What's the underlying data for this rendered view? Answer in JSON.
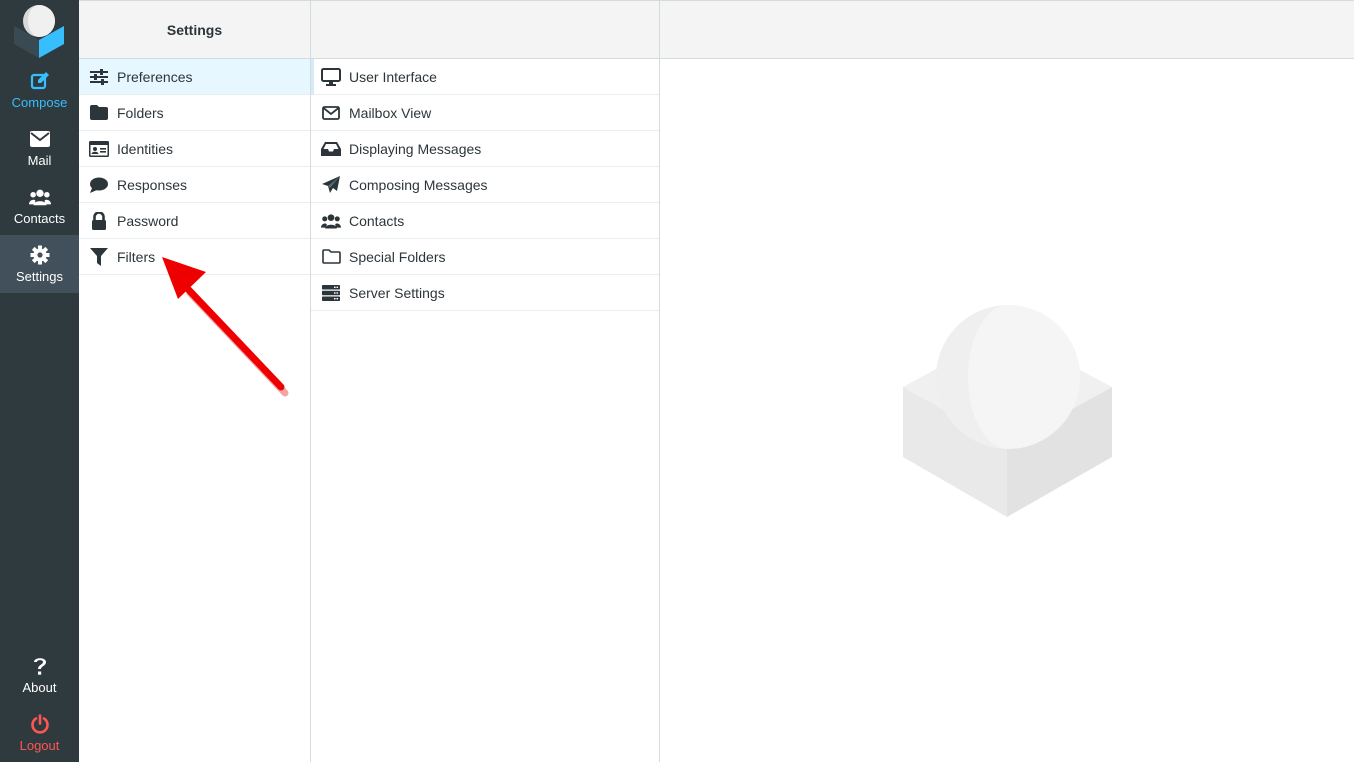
{
  "nav": {
    "items": [
      {
        "label": "Compose",
        "icon": "compose-icon"
      },
      {
        "label": "Mail",
        "icon": "envelope-icon"
      },
      {
        "label": "Contacts",
        "icon": "users-icon"
      },
      {
        "label": "Settings",
        "icon": "gear-icon"
      }
    ],
    "bottom": [
      {
        "label": "About",
        "icon": "question-icon"
      },
      {
        "label": "Logout",
        "icon": "power-icon"
      }
    ]
  },
  "settings": {
    "title": "Settings",
    "items": [
      {
        "label": "Preferences",
        "icon": "sliders-icon"
      },
      {
        "label": "Folders",
        "icon": "folder-icon"
      },
      {
        "label": "Identities",
        "icon": "id-card-icon"
      },
      {
        "label": "Responses",
        "icon": "comment-icon"
      },
      {
        "label": "Password",
        "icon": "lock-icon"
      },
      {
        "label": "Filters",
        "icon": "filter-icon"
      }
    ]
  },
  "preferences": {
    "items": [
      {
        "label": "User Interface",
        "icon": "monitor-icon"
      },
      {
        "label": "Mailbox View",
        "icon": "envelope-outline-icon"
      },
      {
        "label": "Displaying Messages",
        "icon": "inbox-icon"
      },
      {
        "label": "Composing Messages",
        "icon": "paper-plane-icon"
      },
      {
        "label": "Contacts",
        "icon": "users-icon"
      },
      {
        "label": "Special Folders",
        "icon": "folder-outline-icon"
      },
      {
        "label": "Server Settings",
        "icon": "server-icon"
      }
    ]
  },
  "colors": {
    "nav_bg": "#2f3a3f",
    "accent": "#37beff",
    "logout": "#ff5552",
    "selected_bg": "#e7f7ff",
    "annotation_arrow": "#ee0000"
  }
}
